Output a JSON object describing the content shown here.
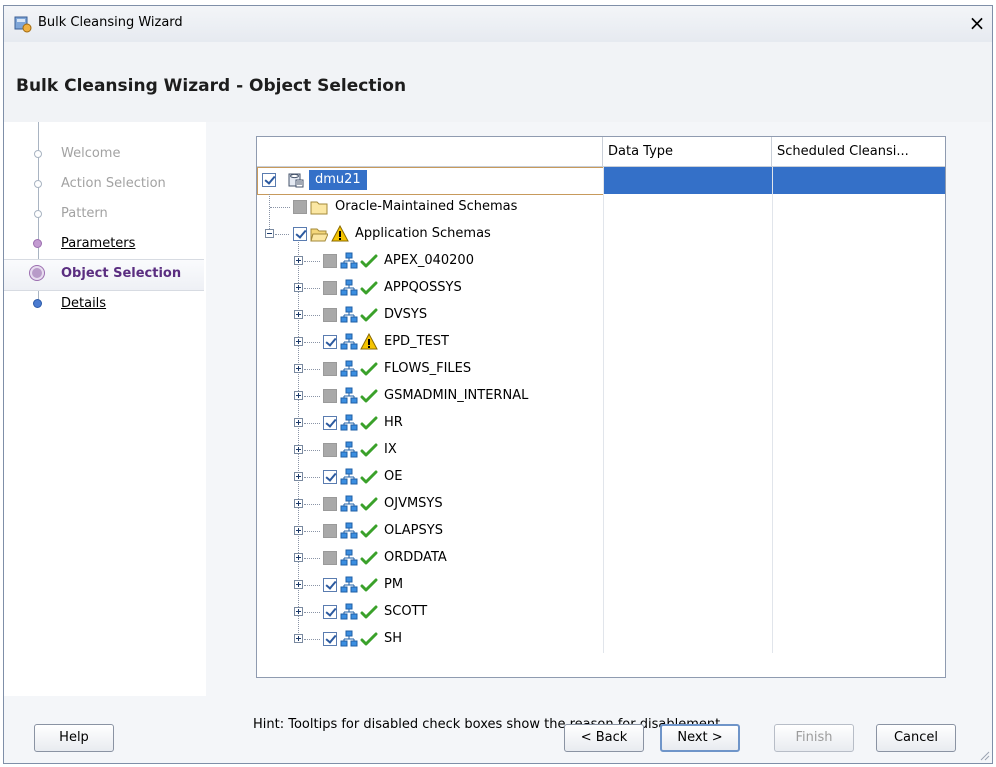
{
  "window": {
    "title": "Bulk Cleansing Wizard",
    "close_glyph": "×"
  },
  "header": {
    "title": "Bulk Cleansing Wizard - Object Selection"
  },
  "nav": {
    "steps": [
      {
        "label": "Welcome",
        "state": "disabled"
      },
      {
        "label": "Action Selection",
        "state": "disabled"
      },
      {
        "label": "Pattern",
        "state": "disabled"
      },
      {
        "label": "Parameters",
        "state": "link"
      },
      {
        "label": "Object Selection",
        "state": "current"
      },
      {
        "label": "Details",
        "state": "link"
      }
    ]
  },
  "table": {
    "columns": [
      "",
      "Data Type",
      "Scheduled Cleansi..."
    ],
    "root": {
      "label": "dmu21",
      "checked": true,
      "icon": "database-icon"
    },
    "groups": [
      {
        "label": "Oracle-Maintained Schemas",
        "checkbox": "disabled",
        "icon": "folder-icon"
      },
      {
        "label": "Application Schemas",
        "checkbox": "checked",
        "icon": "folder-open-icon",
        "status": "warning-icon"
      }
    ],
    "schemas": [
      {
        "label": "APEX_040200",
        "checkbox": "disabled",
        "status": "check-icon"
      },
      {
        "label": "APPQOSSYS",
        "checkbox": "disabled",
        "status": "check-icon"
      },
      {
        "label": "DVSYS",
        "checkbox": "disabled",
        "status": "check-icon"
      },
      {
        "label": "EPD_TEST",
        "checkbox": "checked",
        "status": "warning-icon"
      },
      {
        "label": "FLOWS_FILES",
        "checkbox": "disabled",
        "status": "check-icon"
      },
      {
        "label": "GSMADMIN_INTERNAL",
        "checkbox": "disabled",
        "status": "check-icon"
      },
      {
        "label": "HR",
        "checkbox": "checked",
        "status": "check-icon"
      },
      {
        "label": "IX",
        "checkbox": "disabled",
        "status": "check-icon"
      },
      {
        "label": "OE",
        "checkbox": "checked",
        "status": "check-icon"
      },
      {
        "label": "OJVMSYS",
        "checkbox": "disabled",
        "status": "check-icon"
      },
      {
        "label": "OLAPSYS",
        "checkbox": "disabled",
        "status": "check-icon"
      },
      {
        "label": "ORDDATA",
        "checkbox": "disabled",
        "status": "check-icon"
      },
      {
        "label": "PM",
        "checkbox": "checked",
        "status": "check-icon"
      },
      {
        "label": "SCOTT",
        "checkbox": "checked",
        "status": "check-icon"
      },
      {
        "label": "SH",
        "checkbox": "checked",
        "status": "check-icon"
      }
    ]
  },
  "hint": "Hint: Tooltips for disabled check boxes show the reason for disablement.",
  "buttons": {
    "help": "Help",
    "back": "< Back",
    "next": "Next >",
    "finish": "Finish",
    "cancel": "Cancel"
  },
  "colors": {
    "selection": "#3470c8",
    "current_step": "#5a2d80",
    "check_green": "#3aa12a",
    "warning_yellow": "#f5c400"
  }
}
